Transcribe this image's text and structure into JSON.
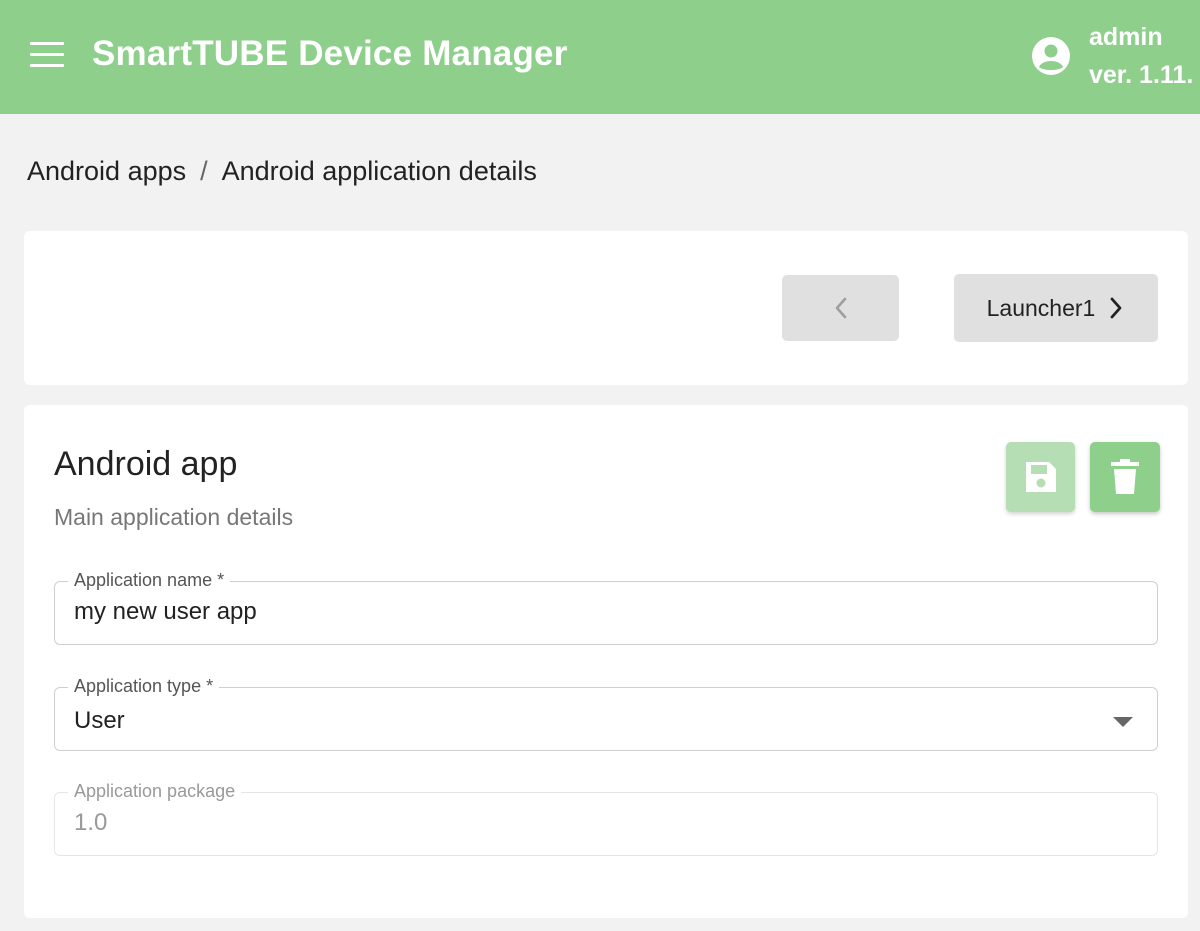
{
  "header": {
    "title": "SmartTUBE Device Manager",
    "username": "admin",
    "version": "ver. 1.11.",
    "background_color": "#8ecf8c"
  },
  "breadcrumb": {
    "items": [
      "Android apps",
      "Android application details"
    ],
    "separator": "/"
  },
  "navigation": {
    "prev_icon": "chevron-left-icon",
    "next_label": "Launcher1",
    "next_icon": "chevron-right-icon"
  },
  "details": {
    "title": "Android app",
    "subtitle": "Main application details",
    "save_icon": "floppy-disk-icon",
    "delete_icon": "trash-icon",
    "fields": {
      "name": {
        "label": "Application name *",
        "value": "my new user app"
      },
      "type": {
        "label": "Application type *",
        "value": "User"
      },
      "package": {
        "label": "Application package",
        "value": "1.0"
      }
    }
  }
}
